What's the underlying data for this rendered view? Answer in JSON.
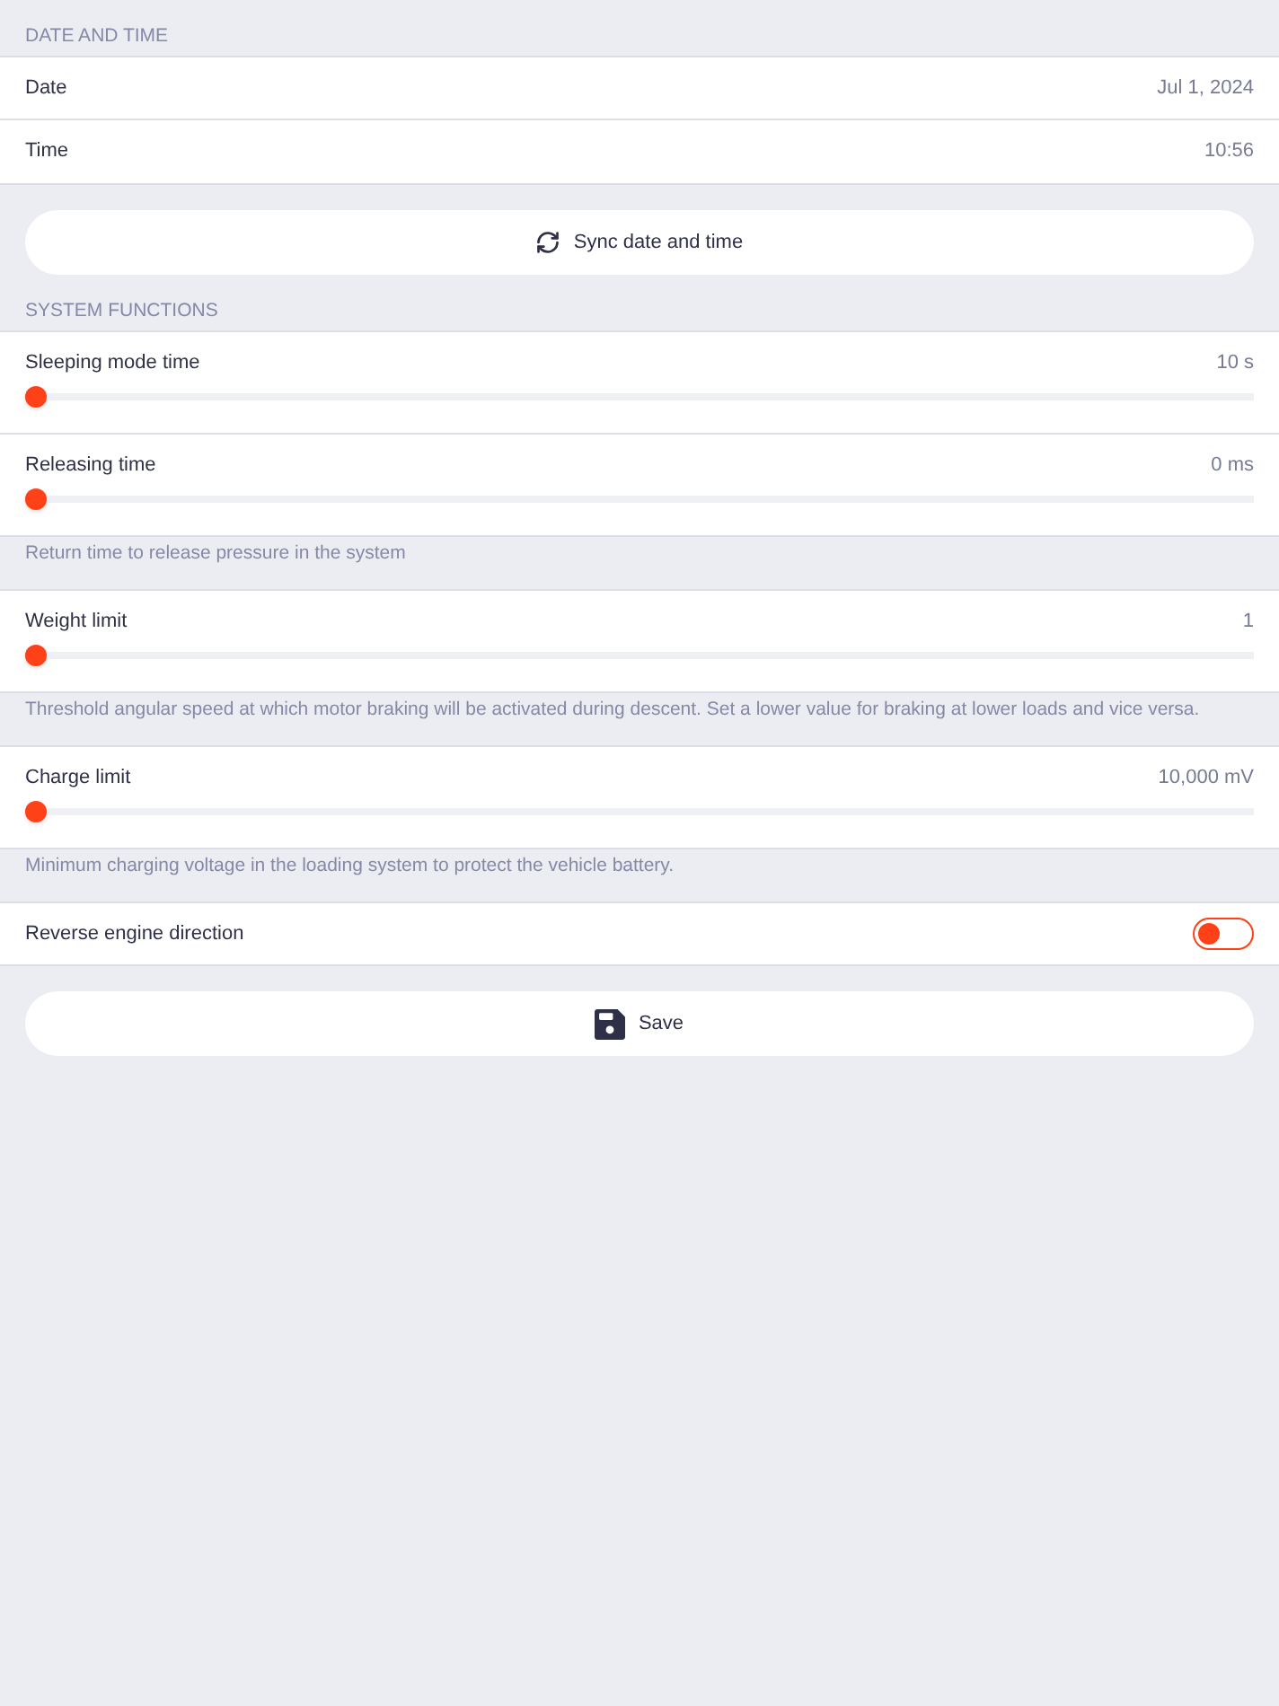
{
  "date_time": {
    "title": "DATE AND TIME",
    "rows": [
      {
        "label": "Date",
        "value": "Jul 1, 2024"
      },
      {
        "label": "Time",
        "value": "10:56"
      }
    ],
    "sync_button": {
      "label": "Sync date and time"
    }
  },
  "system_functions": {
    "title": "SYSTEM FUNCTIONS",
    "items": [
      {
        "kind": "slider",
        "label": "Sleeping mode time",
        "value": "10 s",
        "level": 0
      },
      {
        "kind": "slider",
        "label": "Releasing time",
        "value": "0 ms",
        "level": 0,
        "help": "Return time to release pressure in the system"
      },
      {
        "kind": "slider",
        "label": "Weight limit",
        "value": "1",
        "level": 0,
        "help": "Threshold angular speed at which motor braking will be activated during descent. Set a lower value for braking at lower loads and vice versa."
      },
      {
        "kind": "slider",
        "label": "Charge limit",
        "value": "10,000 mV",
        "level": 0,
        "help": "Minimum charging voltage in the loading system to protect the vehicle battery."
      },
      {
        "kind": "toggle",
        "label": "Reverse engine direction",
        "on": false
      }
    ]
  },
  "save_button": {
    "label": "Save"
  }
}
